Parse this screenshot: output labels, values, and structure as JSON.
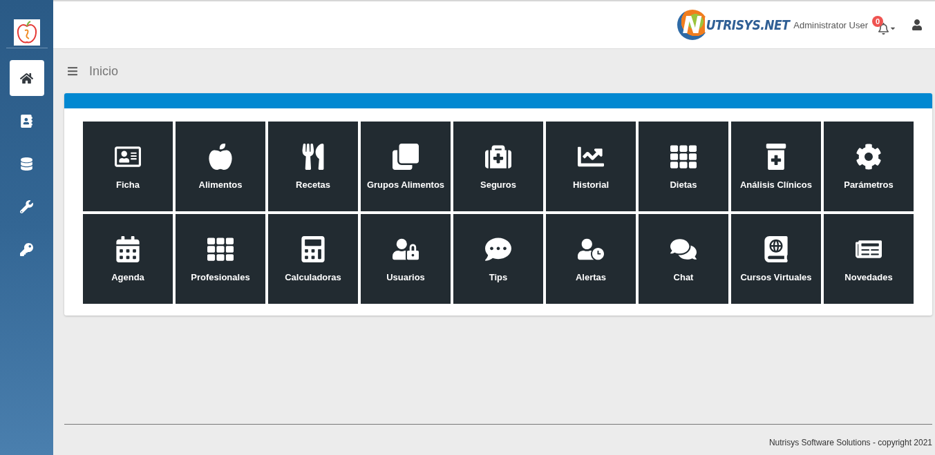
{
  "sidebar": {
    "items": [
      {
        "kind": "home",
        "selected": true
      },
      {
        "kind": "contacts",
        "selected": false
      },
      {
        "kind": "database",
        "selected": false
      },
      {
        "kind": "tools",
        "selected": false
      },
      {
        "kind": "keys",
        "selected": false
      }
    ]
  },
  "header": {
    "brand": {
      "initial": "N",
      "rest": "UTRISYS.NET"
    },
    "user": "Administrator User",
    "notifications": "0"
  },
  "breadcrumb": {
    "title": "Inicio"
  },
  "tiles": [
    {
      "kind": "card",
      "label": "Ficha"
    },
    {
      "kind": "apple",
      "label": "Alimentos"
    },
    {
      "kind": "utensils",
      "label": "Recetas"
    },
    {
      "kind": "clone",
      "label": "Grupos Alimentos"
    },
    {
      "kind": "medkit",
      "label": "Seguros"
    },
    {
      "kind": "chart",
      "label": "Historial"
    },
    {
      "kind": "grid",
      "label": "Dietas"
    },
    {
      "kind": "bottle",
      "label": "Análisis Clínicos"
    },
    {
      "kind": "gear",
      "label": "Parámetros"
    },
    {
      "kind": "calendar",
      "label": "Agenda"
    },
    {
      "kind": "grid",
      "label": "Profesionales"
    },
    {
      "kind": "calculator",
      "label": "Calculadoras"
    },
    {
      "kind": "userlock",
      "label": "Usuarios"
    },
    {
      "kind": "comment",
      "label": "Tips"
    },
    {
      "kind": "userclock",
      "label": "Alertas"
    },
    {
      "kind": "comments",
      "label": "Chat"
    },
    {
      "kind": "atlas",
      "label": "Cursos Virtuales"
    },
    {
      "kind": "news",
      "label": "Novedades"
    }
  ],
  "footer": {
    "text": "Nutrisys Software Solutions - copyright 2021"
  }
}
